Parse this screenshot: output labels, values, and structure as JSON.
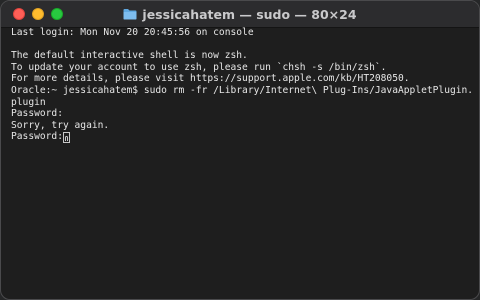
{
  "window": {
    "title": "jessicahatem — sudo — 80×24",
    "title_icon": "folder-icon"
  },
  "terminal": {
    "lines": [
      "Last login: Mon Nov 20 20:45:56 on console",
      "",
      "The default interactive shell is now zsh.",
      "To update your account to use zsh, please run `chsh -s /bin/zsh`.",
      "For more details, please visit https://support.apple.com/kb/HT208050.",
      "Oracle:~ jessicahatem$ sudo rm -fr /Library/Internet\\ Plug-Ins/JavaAppletPlugin.",
      "plugin",
      "Password:",
      "Sorry, try again."
    ],
    "prompt": "Password:",
    "cursor_icon": "key-cursor-icon"
  },
  "colors": {
    "background": "#1e1e1e",
    "text": "#e6e6e6",
    "close": "#ff5f57",
    "minimize": "#febc2e",
    "maximize": "#28c840"
  }
}
